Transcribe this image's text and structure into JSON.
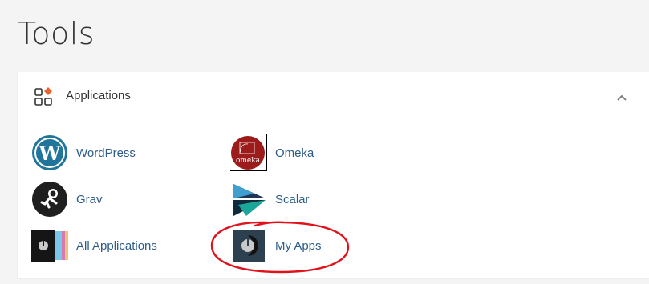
{
  "page": {
    "title": "Tools"
  },
  "panel": {
    "header": {
      "title": "Applications",
      "icon": "apps-grid-icon",
      "collapse_icon": "chevron-up-icon"
    },
    "apps": [
      {
        "label": "WordPress",
        "icon": "wordpress-icon"
      },
      {
        "label": "Omeka",
        "icon": "omeka-icon"
      },
      {
        "label": "Grav",
        "icon": "grav-icon"
      },
      {
        "label": "Scalar",
        "icon": "scalar-icon"
      },
      {
        "label": "All Applications",
        "icon": "all-applications-icon"
      },
      {
        "label": "My Apps",
        "icon": "my-apps-icon"
      }
    ]
  },
  "colors": {
    "link": "#2e5c8a",
    "wordpress": "#21759b",
    "omeka": "#9c1c1c",
    "annotation": "#e0121b",
    "accent_diamond": "#e8622c"
  }
}
